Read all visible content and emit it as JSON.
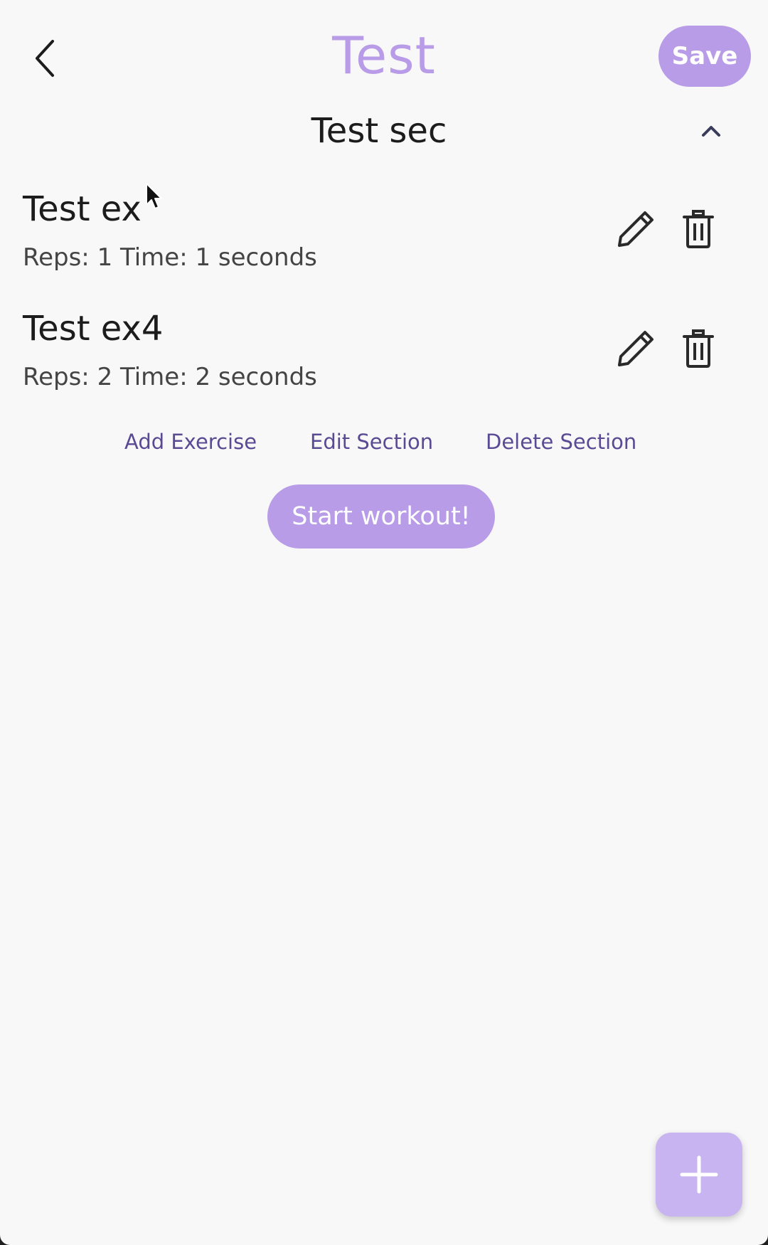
{
  "header": {
    "title": "Test",
    "save_label": "Save"
  },
  "section": {
    "title": "Test sec",
    "expanded": true
  },
  "exercises": [
    {
      "name": "Test ex",
      "details": "Reps: 1 Time: 1 seconds"
    },
    {
      "name": "Test ex4",
      "details": "Reps: 2 Time: 2 seconds"
    }
  ],
  "section_actions": {
    "add_exercise": "Add Exercise",
    "edit_section": "Edit Section",
    "delete_section": "Delete Section"
  },
  "start_workout_label": "Start workout!",
  "icons": {
    "back": "chevron-left-icon",
    "collapse": "chevron-up-icon",
    "edit": "pencil-icon",
    "delete": "trash-icon",
    "fab": "plus-icon"
  },
  "colors": {
    "accent": "#b89ce8",
    "fab": "#c8b4f0",
    "link": "#5a4a94",
    "background": "#f8f8f8"
  }
}
